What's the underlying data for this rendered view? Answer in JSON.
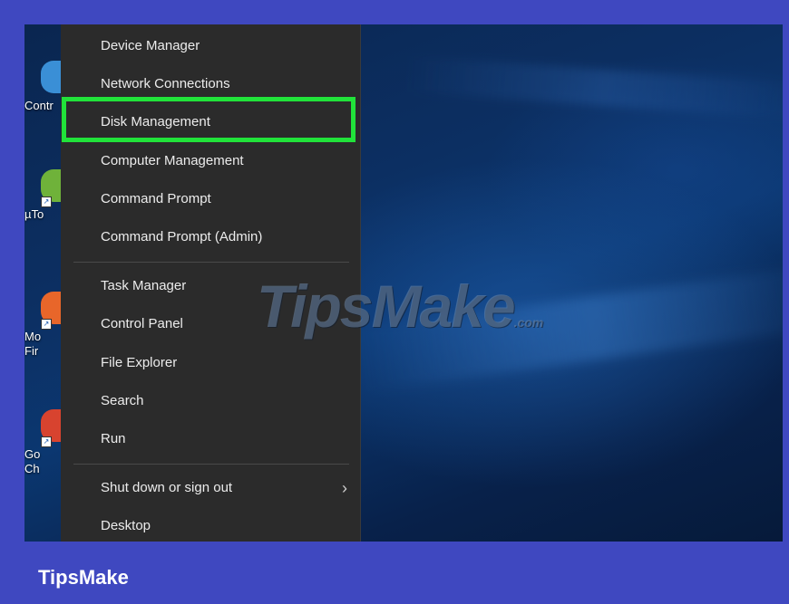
{
  "menu": {
    "items": [
      {
        "label": "Device Manager"
      },
      {
        "label": "Network Connections"
      },
      {
        "label": "Disk Management"
      },
      {
        "label": "Computer Management"
      },
      {
        "label": "Command Prompt"
      },
      {
        "label": "Command Prompt (Admin)"
      },
      {
        "label": "Task Manager"
      },
      {
        "label": "Control Panel"
      },
      {
        "label": "File Explorer"
      },
      {
        "label": "Search"
      },
      {
        "label": "Run"
      },
      {
        "label": "Shut down or sign out"
      },
      {
        "label": "Desktop"
      }
    ],
    "highlighted_item": "Disk Management",
    "highlight_color": "#21e33a"
  },
  "desktop": {
    "icons": [
      {
        "label": "Contr",
        "icon": "control-panel-icon",
        "color": "#3a8fd6"
      },
      {
        "label": "µTo",
        "icon": "utorrent-icon",
        "color": "#6fb23a"
      },
      {
        "label": "Mo\nFir",
        "icon": "firefox-icon",
        "color": "#e8662a"
      },
      {
        "label": "Go\nCh",
        "icon": "chrome-icon",
        "color": "#d8432f"
      }
    ]
  },
  "watermark": {
    "text": "TipsMake",
    "suffix": ".com"
  },
  "footer": {
    "brand": "TipsMake"
  },
  "colors": {
    "frame": "#3f48c0",
    "menu_bg": "#2b2b2b"
  }
}
